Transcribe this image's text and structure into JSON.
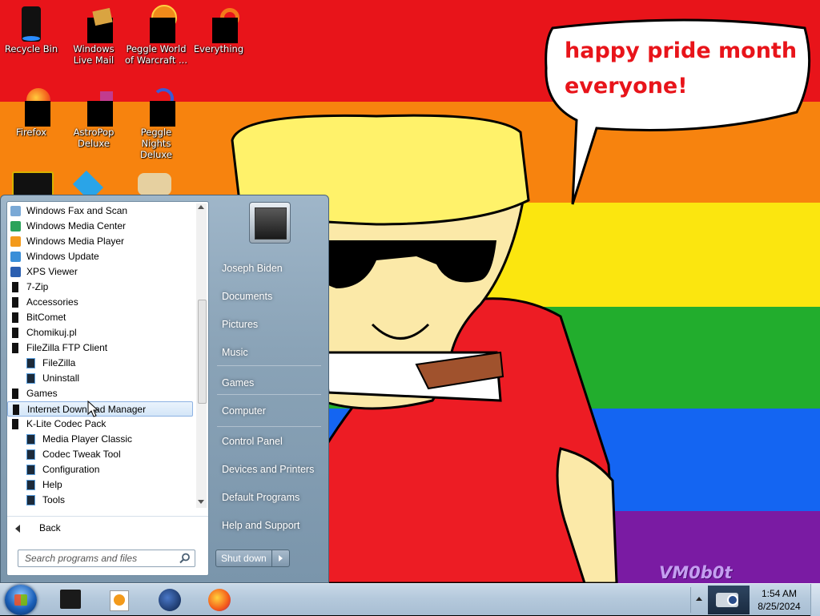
{
  "desktop": {
    "speech_bubble": {
      "line1": "happy pride month",
      "line2": "everyone!"
    },
    "watermark": "VM0b0t",
    "icons": [
      {
        "label": "Recycle Bin"
      },
      {
        "label": "Windows Live Mail"
      },
      {
        "label": "Peggle World of Warcraft ..."
      },
      {
        "label": "Everything"
      },
      {
        "label": "Firefox"
      },
      {
        "label": "AstroPop Deluxe"
      },
      {
        "label": "Peggle Nights Deluxe"
      }
    ]
  },
  "start_menu": {
    "programs": [
      {
        "label": "Windows Fax and Scan",
        "icon": "fax-icon"
      },
      {
        "label": "Windows Media Center",
        "icon": "media-center-icon"
      },
      {
        "label": "Windows Media Player",
        "icon": "media-player-icon"
      },
      {
        "label": "Windows Update",
        "icon": "windows-update-icon"
      },
      {
        "label": "XPS Viewer",
        "icon": "xps-viewer-icon"
      },
      {
        "label": "7-Zip",
        "icon": "folder-icon"
      },
      {
        "label": "Accessories",
        "icon": "folder-icon"
      },
      {
        "label": "BitComet",
        "icon": "folder-icon"
      },
      {
        "label": "Chomikuj.pl",
        "icon": "folder-icon"
      },
      {
        "label": "FileZilla FTP Client",
        "icon": "folder-icon"
      },
      {
        "label": "FileZilla",
        "icon": "app-icon"
      },
      {
        "label": "Uninstall",
        "icon": "app-icon"
      },
      {
        "label": "Games",
        "icon": "folder-icon"
      },
      {
        "label": "Internet Download Manager",
        "icon": "folder-icon"
      },
      {
        "label": "K-Lite Codec Pack",
        "icon": "folder-icon"
      },
      {
        "label": "Media Player Classic",
        "icon": "app-icon"
      },
      {
        "label": "Codec Tweak Tool",
        "icon": "app-icon"
      },
      {
        "label": "Configuration",
        "icon": "app-icon"
      },
      {
        "label": "Help",
        "icon": "app-icon"
      },
      {
        "label": "Tools",
        "icon": "app-icon"
      }
    ],
    "highlighted_index": 13,
    "back_label": "Back",
    "search_placeholder": "Search programs and files",
    "right_items": [
      "Joseph Biden",
      "Documents",
      "Pictures",
      "Music",
      "Games",
      "Computer",
      "Control Panel",
      "Devices and Printers",
      "Default Programs",
      "Help and Support"
    ],
    "shutdown_label": "Shut down"
  },
  "taskbar": {
    "time": "1:54 AM",
    "date": "8/25/2024",
    "pinned": [
      "terminal-icon",
      "media-player-icon",
      "steam-icon",
      "firefox-icon"
    ]
  },
  "colors": {
    "red": "#e8141a",
    "orange": "#f7830e",
    "yellow": "#fbe60f",
    "green": "#22ad2d",
    "blue": "#1465f2",
    "purple": "#7a1ba3"
  }
}
